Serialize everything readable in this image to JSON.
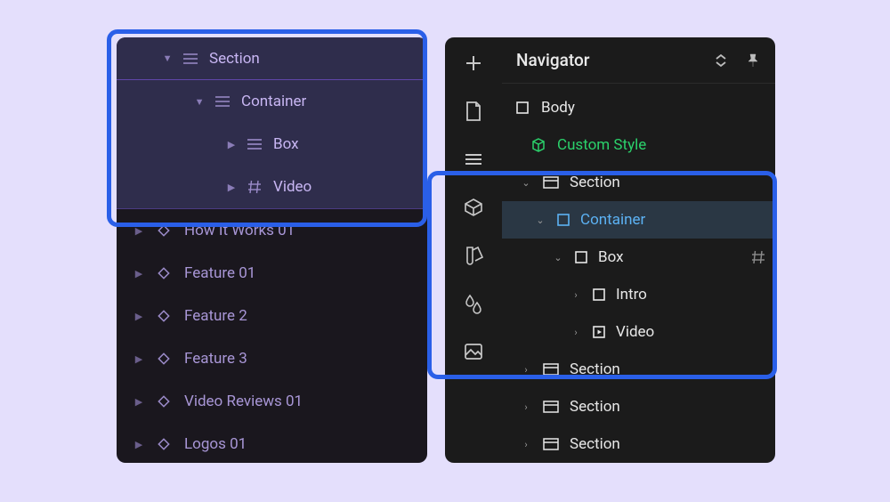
{
  "colors": {
    "page_bg": "#e4dffc",
    "highlight_border": "#2a5fe8",
    "left_panel_bg": "#1a171e",
    "left_header_bg": "#2f2d4c",
    "right_panel_bg": "#1b1b1b",
    "nav_cssclass_color": "#2bd16b",
    "nav_selected_color": "#5cb2f4"
  },
  "left_panel": {
    "highlighted_tree": [
      {
        "label": "Section",
        "indent": 1,
        "expanded": true,
        "icon": "lines"
      },
      {
        "label": "Container",
        "indent": 2,
        "expanded": true,
        "icon": "lines"
      },
      {
        "label": "Box",
        "indent": 3,
        "expanded": false,
        "icon": "lines"
      },
      {
        "label": "Video",
        "indent": 3,
        "expanded": false,
        "icon": "hash"
      }
    ],
    "rest": [
      {
        "label": "How It Works 01",
        "icon": "diamond"
      },
      {
        "label": "Feature 01",
        "icon": "diamond"
      },
      {
        "label": "Feature 2",
        "icon": "diamond"
      },
      {
        "label": "Feature 3",
        "icon": "diamond"
      },
      {
        "label": "Video Reviews 01",
        "icon": "diamond"
      },
      {
        "label": "Logos 01",
        "icon": "diamond"
      }
    ]
  },
  "right_panel": {
    "title": "Navigator",
    "rail_icons": [
      "plus",
      "page",
      "menu",
      "cube",
      "swatches",
      "droplets",
      "image"
    ],
    "tree": [
      {
        "label": "Body",
        "indent": 0,
        "icon": "box",
        "chev": null
      },
      {
        "label": "Custom Style",
        "indent": 1,
        "icon": "package",
        "style": "green",
        "chev": null
      },
      {
        "label": "Section",
        "indent": 2,
        "icon": "section",
        "chev": "down"
      },
      {
        "label": "Container",
        "indent": 3,
        "icon": "box",
        "chev": "down",
        "style": "blue",
        "selected": true
      },
      {
        "label": "Box",
        "indent": 4,
        "icon": "box",
        "chev": "down",
        "trailing": "grid"
      },
      {
        "label": "Intro",
        "indent": 5,
        "icon": "box",
        "chev": "right"
      },
      {
        "label": "Video",
        "indent": 5,
        "icon": "play",
        "chev": "right"
      },
      {
        "label": "Section",
        "indent": 2,
        "icon": "section",
        "chev": "right"
      },
      {
        "label": "Section",
        "indent": 2,
        "icon": "section",
        "chev": "right"
      },
      {
        "label": "Section",
        "indent": 2,
        "icon": "section",
        "chev": "right"
      }
    ]
  }
}
